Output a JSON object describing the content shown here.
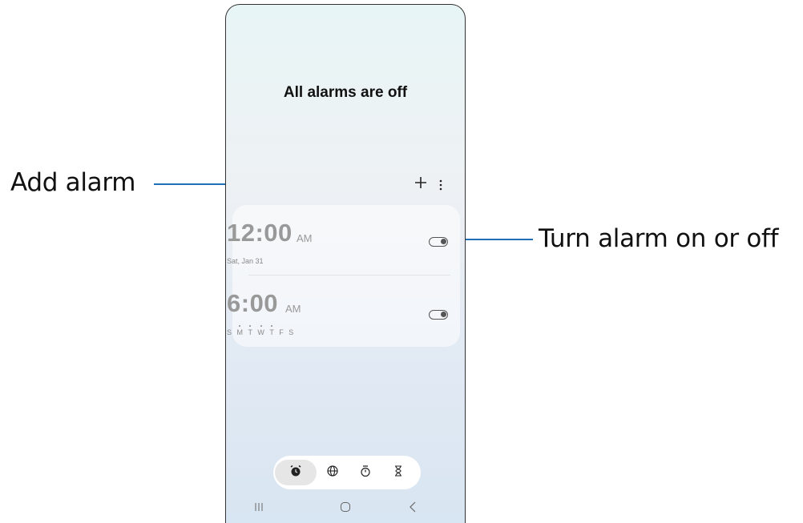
{
  "callouts": {
    "add_alarm": "Add alarm",
    "toggle": "Turn alarm on or off"
  },
  "screen": {
    "title": "All alarms are off",
    "toolbar": {
      "add_icon": "plus-icon",
      "more_icon": "more-vertical-icon"
    },
    "alarms": [
      {
        "time": "12:00",
        "ampm": "AM",
        "subtitle": "Sat, Jan 31",
        "enabled": false
      },
      {
        "time": "6:00",
        "ampm": "AM",
        "days": [
          "S",
          "M",
          "T",
          "W",
          "T",
          "F",
          "S"
        ],
        "enabled": false
      }
    ],
    "bottom_nav": [
      {
        "name": "alarm",
        "icon": "alarm-clock-icon",
        "active": true
      },
      {
        "name": "world-clock",
        "icon": "globe-icon",
        "active": false
      },
      {
        "name": "stopwatch",
        "icon": "stopwatch-icon",
        "active": false
      },
      {
        "name": "timer",
        "icon": "hourglass-icon",
        "active": false
      }
    ],
    "system_nav": [
      "recent-apps-icon",
      "home-icon",
      "back-icon"
    ]
  },
  "colors": {
    "callout_line": "#1e6fb3",
    "time_text": "#999999"
  }
}
